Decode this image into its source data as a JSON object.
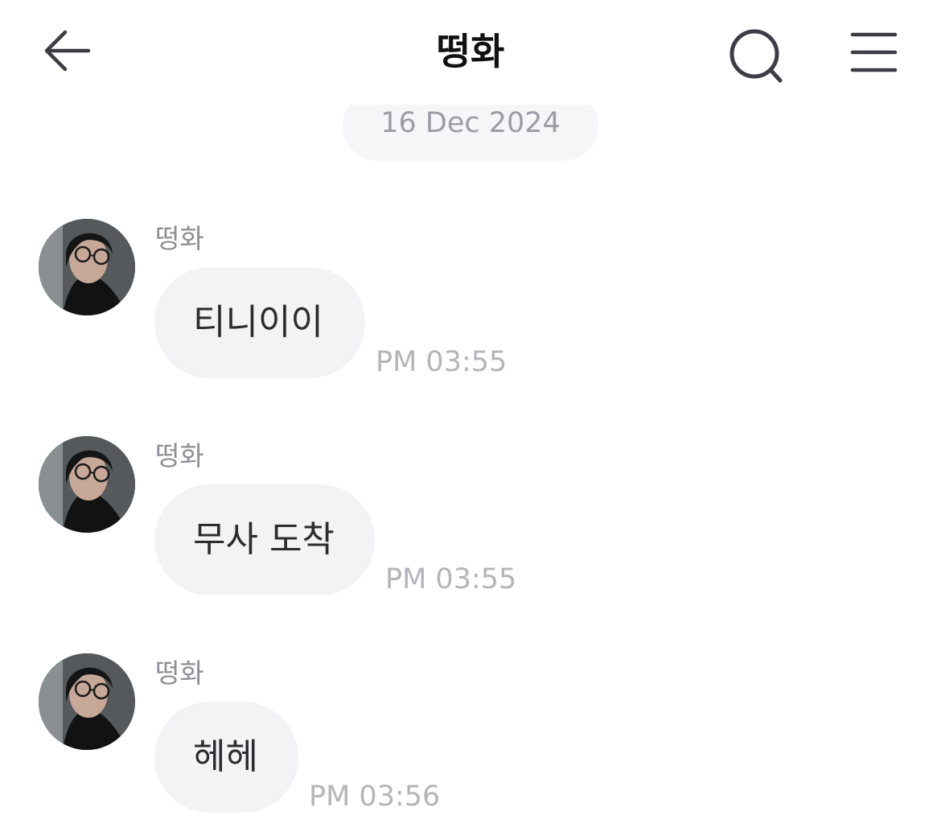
{
  "header": {
    "back_icon": "arrow-left-icon",
    "title": "떵화",
    "search_icon": "search-icon",
    "menu_icon": "hamburger-menu-icon"
  },
  "date_divider": {
    "label": "16 Dec 2024"
  },
  "messages": [
    {
      "sender": "떵화",
      "text": "티니이이",
      "time": "PM 03:55"
    },
    {
      "sender": "떵화",
      "text": "무사 도착",
      "time": "PM 03:55"
    },
    {
      "sender": "떵화",
      "text": "헤헤",
      "time": "PM 03:56"
    }
  ],
  "colors": {
    "bubble": "#f3f3f6",
    "date_pill": "#f6f6f9",
    "time_text": "#b4b4ba",
    "sender_text": "#8d8d94"
  }
}
